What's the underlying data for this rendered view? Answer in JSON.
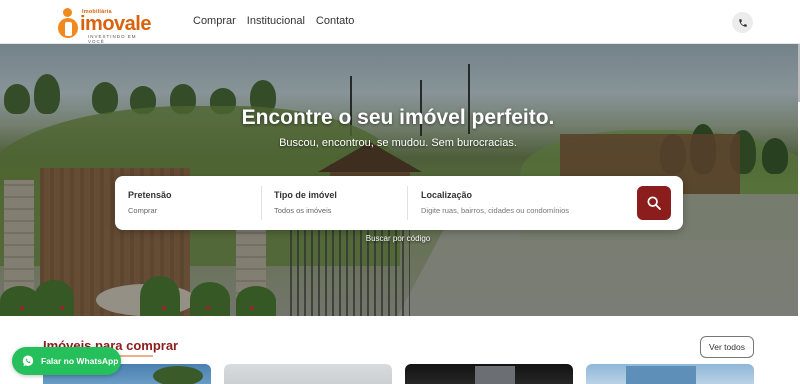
{
  "brand": {
    "top_word": "Imobiliária",
    "name": "imovale",
    "tagline": "INVESTINDO EM VOCÊ",
    "accent_color": "#d9620e",
    "primary_color": "#8b1d1d"
  },
  "nav": {
    "items": [
      {
        "label": "Comprar"
      },
      {
        "label": "Institucional"
      },
      {
        "label": "Contato"
      }
    ],
    "phone_icon": "phone-icon"
  },
  "hero": {
    "title": "Encontre o seu imóvel perfeito.",
    "subtitle": "Buscou, encontrou, se mudou. Sem burocracias."
  },
  "search": {
    "purpose": {
      "label": "Pretensão",
      "value": "Comprar"
    },
    "type": {
      "label": "Tipo de imóvel",
      "value": "Todos os imóveis"
    },
    "location": {
      "label": "Localização",
      "placeholder": "Digite ruas, bairros, cidades ou condomínios"
    },
    "button_icon": "search-icon",
    "code_link": "Buscar por código"
  },
  "listings": {
    "title": "Imóveis para comprar",
    "see_all": "Ver todos"
  },
  "whatsapp": {
    "label": "Falar no WhatsApp",
    "icon": "whatsapp-icon",
    "color": "#25c05c"
  }
}
